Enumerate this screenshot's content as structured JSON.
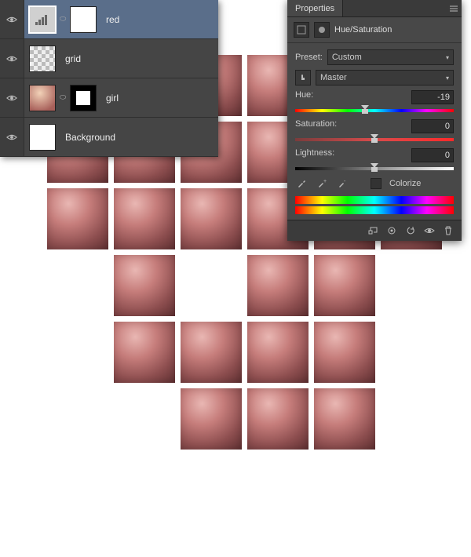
{
  "layers": {
    "items": [
      {
        "name": "red",
        "selected": true,
        "thumbs": [
          "adj",
          "mask-white"
        ]
      },
      {
        "name": "grid",
        "selected": false,
        "thumbs": [
          "grid-th"
        ]
      },
      {
        "name": "girl",
        "selected": false,
        "thumbs": [
          "girl",
          "mask-black"
        ]
      },
      {
        "name": "Background",
        "selected": false,
        "thumbs": [
          "mask-white"
        ]
      }
    ]
  },
  "properties": {
    "panel_title": "Properties",
    "adj_title": "Hue/Saturation",
    "preset_label": "Preset:",
    "preset_value": "Custom",
    "range_value": "Master",
    "hue": {
      "label": "Hue:",
      "value": "-19",
      "pos": 44
    },
    "sat": {
      "label": "Saturation:",
      "value": "0",
      "pos": 50
    },
    "light": {
      "label": "Lightness:",
      "value": "0",
      "pos": 50
    },
    "colorize_label": "Colorize"
  },
  "tile_map": [
    [
      0,
      0,
      1,
      1,
      0,
      1
    ],
    [
      1,
      1,
      1,
      1,
      1,
      1
    ],
    [
      1,
      1,
      1,
      1,
      1,
      1
    ],
    [
      0,
      1,
      0,
      1,
      1,
      0
    ],
    [
      0,
      1,
      1,
      1,
      1,
      0
    ],
    [
      0,
      0,
      1,
      1,
      1,
      0
    ]
  ]
}
